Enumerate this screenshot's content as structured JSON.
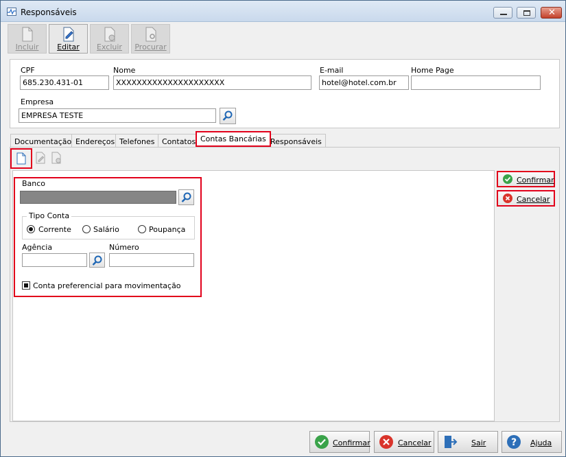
{
  "window": {
    "title": "Responsáveis"
  },
  "toolbar": {
    "buttons": [
      {
        "label": "Incluir",
        "enabled": false,
        "icon": "new-document-icon"
      },
      {
        "label": "Editar",
        "enabled": true,
        "icon": "edit-document-icon"
      },
      {
        "label": "Excluir",
        "enabled": false,
        "icon": "delete-document-icon"
      },
      {
        "label": "Procurar",
        "enabled": false,
        "icon": "search-document-icon"
      }
    ]
  },
  "header": {
    "cpf_label": "CPF",
    "cpf_value": "685.230.431-01",
    "nome_label": "Nome",
    "nome_value": "XXXXXXXXXXXXXXXXXXXXX",
    "email_label": "E-mail",
    "email_value": "hotel@hotel.com.br",
    "homepage_label": "Home Page",
    "homepage_value": "",
    "empresa_label": "Empresa",
    "empresa_value": "EMPRESA TESTE"
  },
  "tabs": [
    {
      "label": "Documentação"
    },
    {
      "label": "Endereços"
    },
    {
      "label": "Telefones"
    },
    {
      "label": "Contatos"
    },
    {
      "label": "Contas Bancárias",
      "selected": true
    },
    {
      "label": "Responsáveis"
    }
  ],
  "form": {
    "banco_label": "Banco",
    "banco_value": "",
    "tipo_conta_title": "Tipo Conta",
    "tipo_conta_options": [
      {
        "label": "Corrente",
        "checked": true
      },
      {
        "label": "Salário",
        "checked": false
      },
      {
        "label": "Poupança",
        "checked": false
      }
    ],
    "agencia_label": "Agência",
    "agencia_value": "",
    "numero_label": "Número",
    "numero_value": "",
    "preferencial_label": "Conta preferencial para movimentação",
    "preferencial_checked": true
  },
  "side_actions": {
    "confirm_label": "Confirmar",
    "cancel_label": "Cancelar"
  },
  "footer": {
    "confirm_label": "Confirmar",
    "cancel_label": "Cancelar",
    "exit_label": "Sair",
    "help_label": "Ajuda"
  },
  "colors": {
    "highlight": "#e2001a",
    "confirm_green": "#3aa34a",
    "cancel_red": "#d9342b",
    "help_blue": "#2d6fb8"
  }
}
